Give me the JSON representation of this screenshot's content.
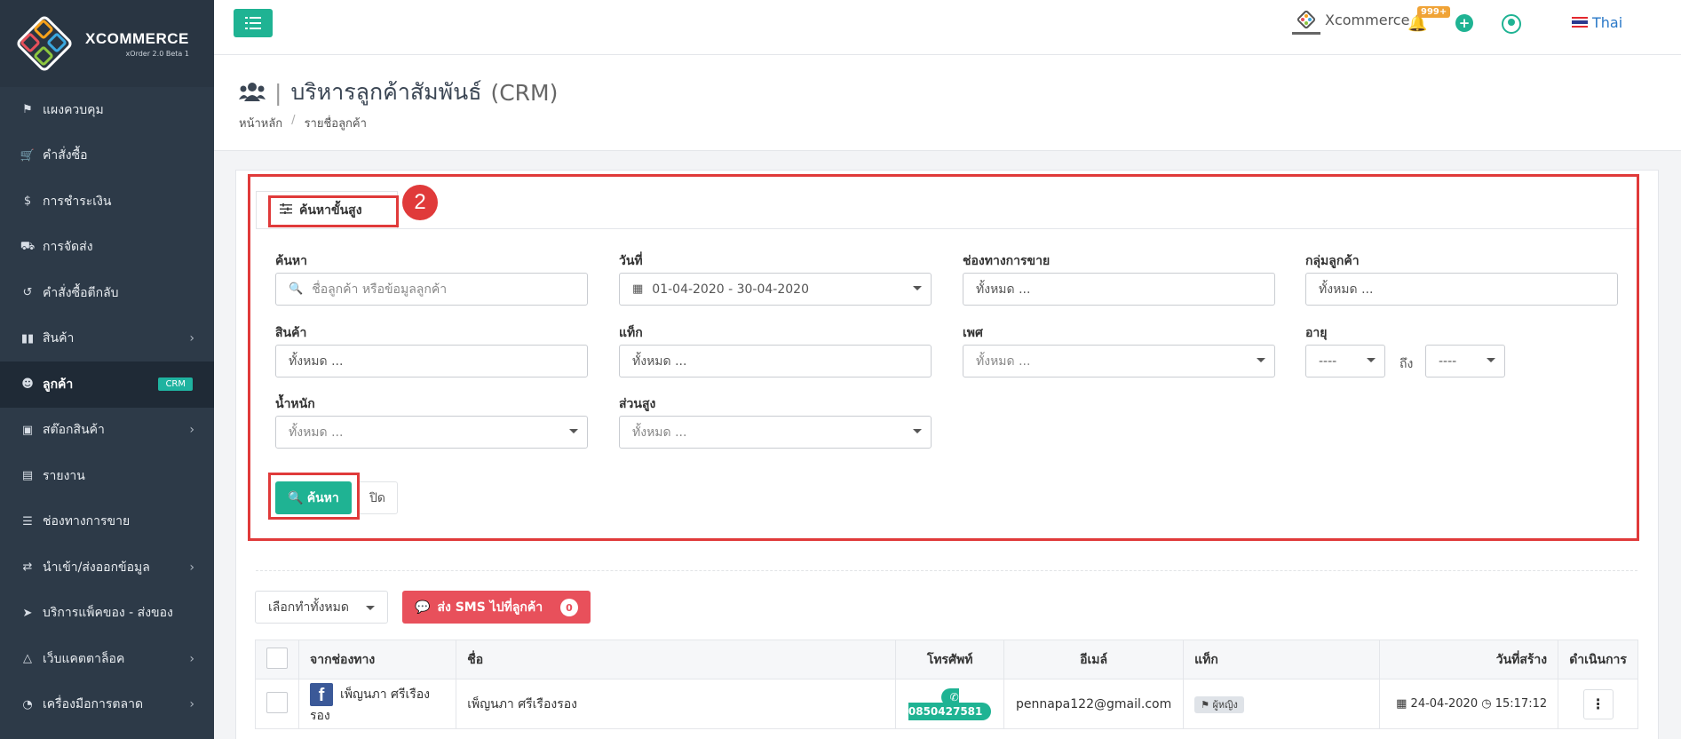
{
  "brand": {
    "title": "XCOMMERCE",
    "version": "xOrder 2.0 Beta 1"
  },
  "sidebar": {
    "items": [
      {
        "label": "แผงควบคุม",
        "icon": "flag-icon",
        "chevron": false
      },
      {
        "label": "คำสั่งซื้อ",
        "icon": "cart-icon",
        "chevron": false
      },
      {
        "label": "การชำระเงิน",
        "icon": "dollar-icon",
        "chevron": false
      },
      {
        "label": "การจัดส่ง",
        "icon": "truck-icon",
        "chevron": false
      },
      {
        "label": "คำสั่งซื้อตีกลับ",
        "icon": "undo-icon",
        "chevron": false
      },
      {
        "label": "สินค้า",
        "icon": "barcode-icon",
        "chevron": true
      },
      {
        "label": "ลูกค้า",
        "icon": "users-icon",
        "chevron": false,
        "active": true,
        "badge": "CRM"
      },
      {
        "label": "สต๊อกสินค้า",
        "icon": "cubes-icon",
        "chevron": true
      },
      {
        "label": "รายงาน",
        "icon": "bar-chart-icon",
        "chevron": false
      },
      {
        "label": "ช่องทางการขาย",
        "icon": "list-icon",
        "chevron": false
      },
      {
        "label": "นำเข้า/ส่งออกข้อมูล",
        "icon": "exchange-icon",
        "chevron": true
      },
      {
        "label": "บริการแพ็คของ - ส่งของ",
        "icon": "paper-plane-icon",
        "chevron": false
      },
      {
        "label": "เว็บแคตตาล็อค",
        "icon": "basket-icon",
        "chevron": true
      },
      {
        "label": "เครื่องมือการตลาด",
        "icon": "dashboard-icon",
        "chevron": true
      }
    ]
  },
  "topbar": {
    "brand_name": "Xcommerce",
    "notification_count": "999+",
    "language": "Thai"
  },
  "header": {
    "title": "บริหารลูกค้าสัมพันธ์",
    "title_suffix": "(CRM)",
    "breadcrumb": [
      "หน้าหลัก",
      "รายชื่อลูกค้า"
    ]
  },
  "annotation": {
    "step": "2"
  },
  "search": {
    "tab_label": "ค้นหาขั้นสูง",
    "labels": {
      "keyword": "ค้นหา",
      "date": "วันที่",
      "channel": "ช่องทางการขาย",
      "group": "กลุ่มลูกค้า",
      "product": "สินค้า",
      "tag": "แท็ก",
      "gender": "เพศ",
      "age": "อายุ",
      "weight": "น้ำหนัก",
      "height": "ส่วนสูง"
    },
    "keyword_placeholder": "ชื่อลูกค้า หรือข้อมูลลูกค้า",
    "date_value": "01-04-2020 - 30-04-2020",
    "all_placeholder": "ทั้งหมด ...",
    "age_from": "----",
    "age_to": "----",
    "to_text": "ถึง",
    "search_button": "ค้นหา",
    "close_button": "ปิด"
  },
  "actions": {
    "select_all": "เลือกทำทั้งหมด",
    "sms_button": "ส่ง SMS ไปที่ลูกค้า",
    "sms_count": "0"
  },
  "table": {
    "columns": [
      "จากช่องทาง",
      "ชื่อ",
      "โทรศัพท์",
      "อีเมล์",
      "แท็ก",
      "วันที่สร้าง",
      "ดำเนินการ"
    ],
    "rows": [
      {
        "channel_name": "เพ็ญนภา ศรีเรืองรอง",
        "name": "เพ็ญนภา ศรีเรืองรอง",
        "phone": "0850427581",
        "email": "pennapa122@gmail.com",
        "tag": "ผู้หญิง",
        "date": "24-04-2020",
        "time": "15:17:12"
      }
    ]
  },
  "colors": {
    "primary": "#1fb393",
    "danger": "#e8505b",
    "sidebar": "#2d3a48",
    "annotation": "#e03a3a"
  }
}
